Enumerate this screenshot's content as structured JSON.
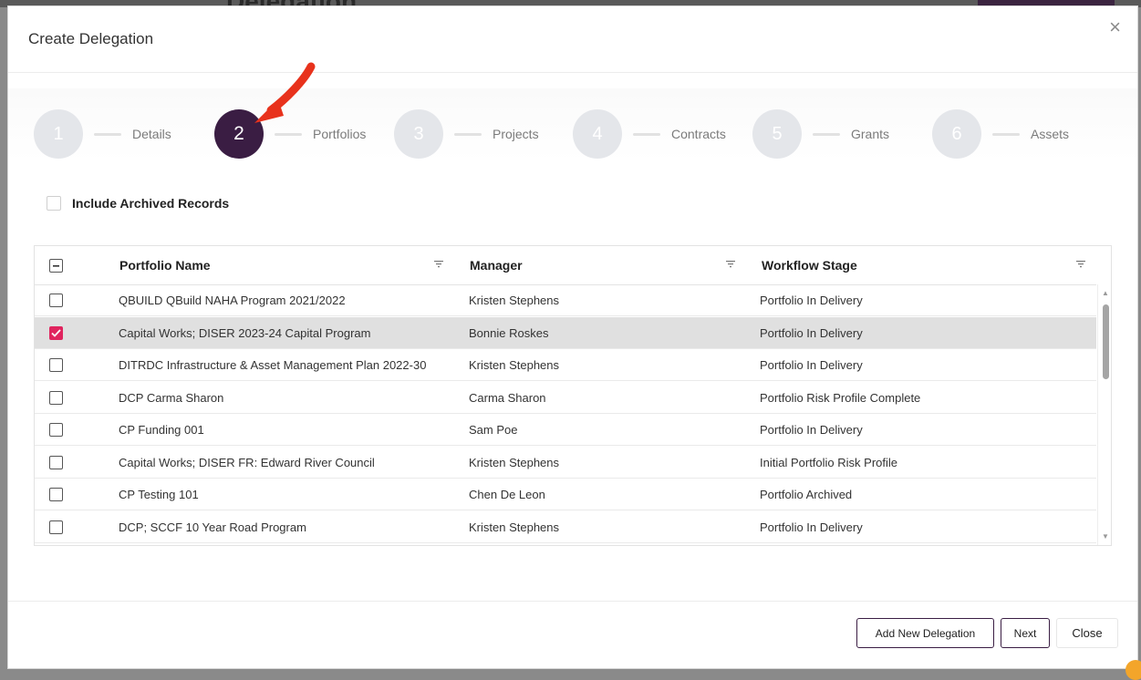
{
  "background": {
    "title": "Delegation"
  },
  "modal": {
    "title": "Create Delegation",
    "close_icon": "×"
  },
  "stepper": {
    "steps": [
      {
        "number": "1",
        "label": "Details",
        "active": false
      },
      {
        "number": "2",
        "label": "Portfolios",
        "active": true
      },
      {
        "number": "3",
        "label": "Projects",
        "active": false
      },
      {
        "number": "4",
        "label": "Contracts",
        "active": false
      },
      {
        "number": "5",
        "label": "Grants",
        "active": false
      },
      {
        "number": "6",
        "label": "Assets",
        "active": false
      }
    ]
  },
  "archived": {
    "label": "Include Archived Records",
    "checked": false
  },
  "grid": {
    "columns": [
      "Portfolio Name",
      "Manager",
      "Workflow Stage"
    ],
    "rows": [
      {
        "name": "QBUILD QBuild NAHA Program 2021/2022",
        "manager": "Kristen Stephens",
        "stage": "Portfolio In Delivery",
        "checked": false
      },
      {
        "name": "Capital Works; DISER 2023-24 Capital Program",
        "manager": "Bonnie Roskes",
        "stage": "Portfolio In Delivery",
        "checked": true
      },
      {
        "name": "DITRDC Infrastructure & Asset Management Plan 2022-30",
        "manager": "Kristen Stephens",
        "stage": "Portfolio In Delivery",
        "checked": false
      },
      {
        "name": "DCP Carma Sharon",
        "manager": "Carma Sharon",
        "stage": "Portfolio Risk Profile Complete",
        "checked": false
      },
      {
        "name": "CP Funding 001",
        "manager": "Sam Poe",
        "stage": "Portfolio In Delivery",
        "checked": false
      },
      {
        "name": "Capital Works; DISER FR: Edward River Council",
        "manager": "Kristen Stephens",
        "stage": "Initial Portfolio Risk Profile",
        "checked": false
      },
      {
        "name": "CP Testing 101",
        "manager": "Chen De Leon",
        "stage": "Portfolio Archived",
        "checked": false
      },
      {
        "name": "DCP; SCCF 10 Year Road Program",
        "manager": "Kristen Stephens",
        "stage": "Portfolio In Delivery",
        "checked": false
      }
    ]
  },
  "footer": {
    "add_label": "Add New Delegation",
    "next_label": "Next",
    "close_label": "Close"
  },
  "colors": {
    "accent": "#3a1d43",
    "check": "#e0245e",
    "arrow": "#e8321c"
  }
}
